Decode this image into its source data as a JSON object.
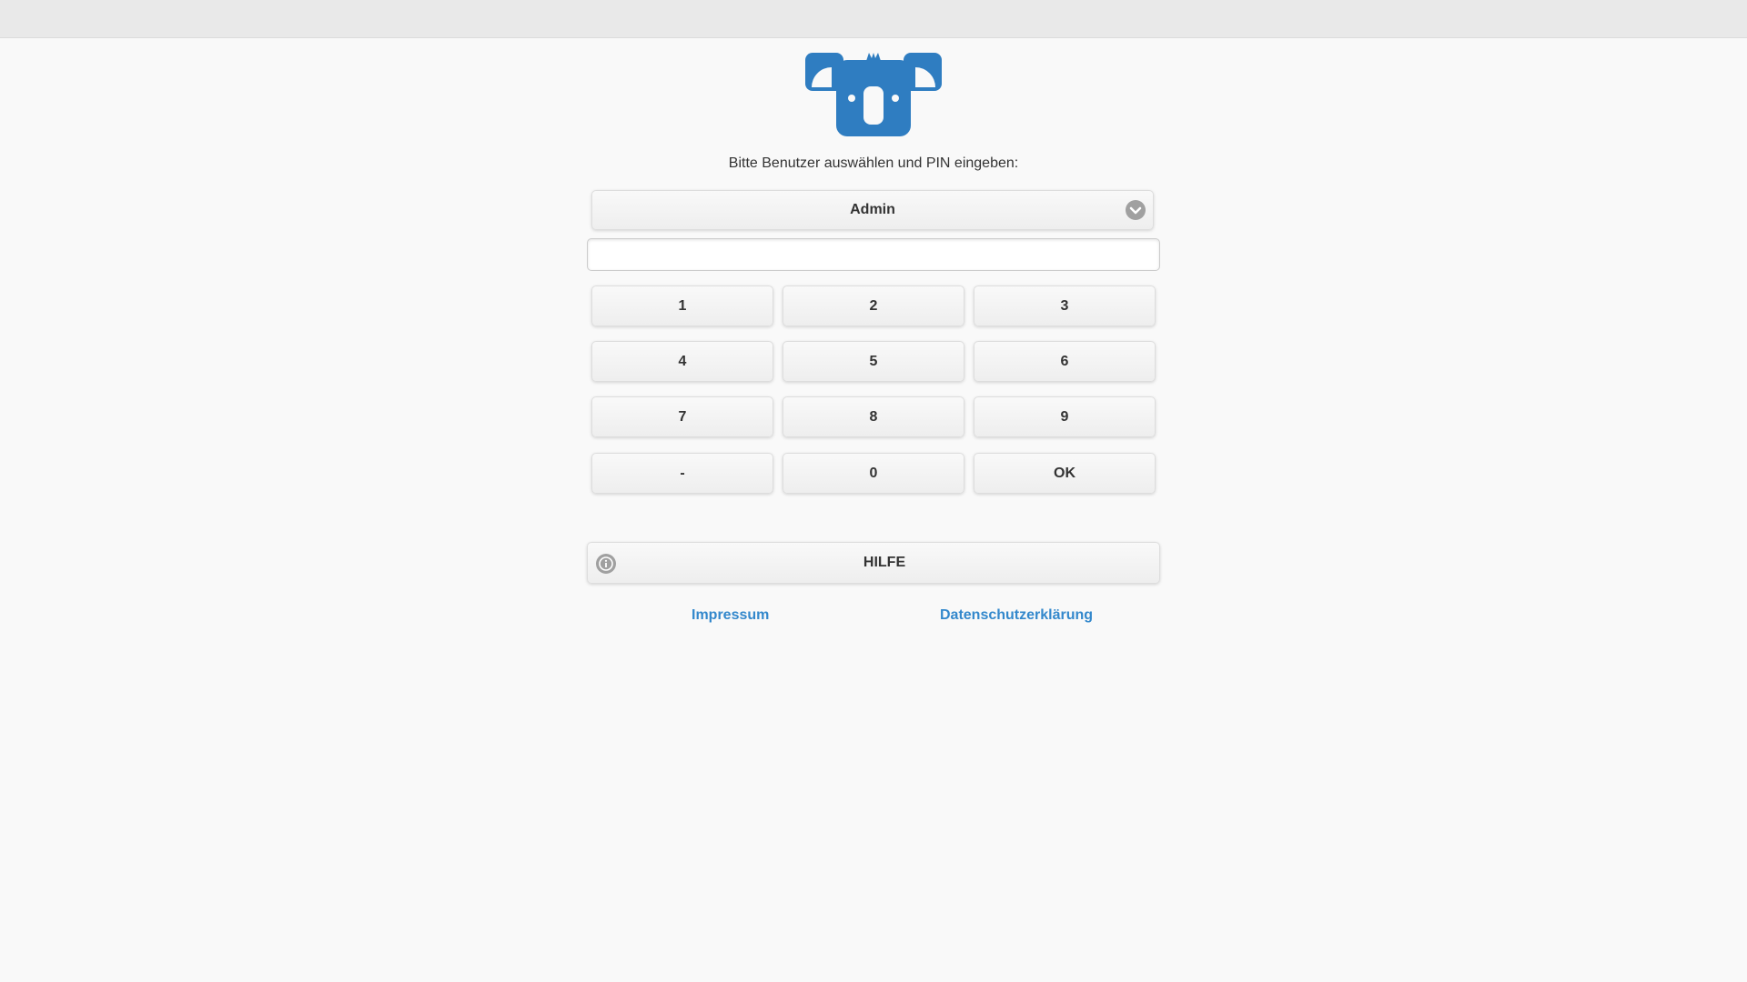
{
  "logo": {
    "icon": "koala-logo",
    "color": "#2f7dc1"
  },
  "prompt": "Bitte Benutzer auswählen und PIN eingeben:",
  "user_select": {
    "selected": "Admin",
    "icon": "chevron-down-icon"
  },
  "pin_input": {
    "value": "",
    "placeholder": ""
  },
  "keypad": {
    "keys": [
      "1",
      "2",
      "3",
      "4",
      "5",
      "6",
      "7",
      "8",
      "9",
      "-",
      "0",
      "OK"
    ]
  },
  "help": {
    "label": "HILFE",
    "icon": "info-icon"
  },
  "footer": {
    "impressum": "Impressum",
    "datenschutz": "Datenschutzerklärung",
    "link_color": "#3388cc"
  }
}
